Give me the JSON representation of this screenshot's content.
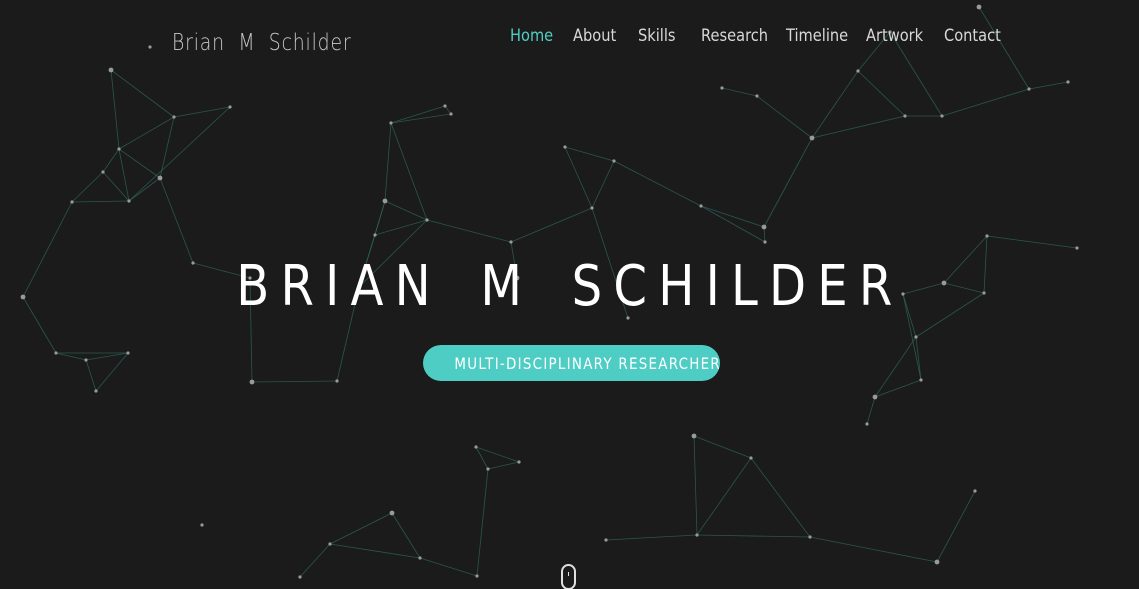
{
  "brand": {
    "name": "Brian  M  Schilder"
  },
  "nav": {
    "items": [
      {
        "label": "Home",
        "active": true
      },
      {
        "label": "About",
        "active": false
      },
      {
        "label": "Skills",
        "active": false
      },
      {
        "label": "Research",
        "active": false
      },
      {
        "label": "Timeline",
        "active": false
      },
      {
        "label": "Artwork",
        "active": false
      },
      {
        "label": "Contact",
        "active": false
      }
    ]
  },
  "hero": {
    "title": "BRIAN M SCHILDER",
    "cta_label": "MULTI-DISCIPLINARY RESEARCHER"
  },
  "scroll_indicator": {
    "icon": "mouse-scroll-icon"
  },
  "colors": {
    "background": "#1b1b1b",
    "accent": "#4ecdc4",
    "network_line": "#2f6b5f",
    "network_node": "#9a9a9a"
  }
}
